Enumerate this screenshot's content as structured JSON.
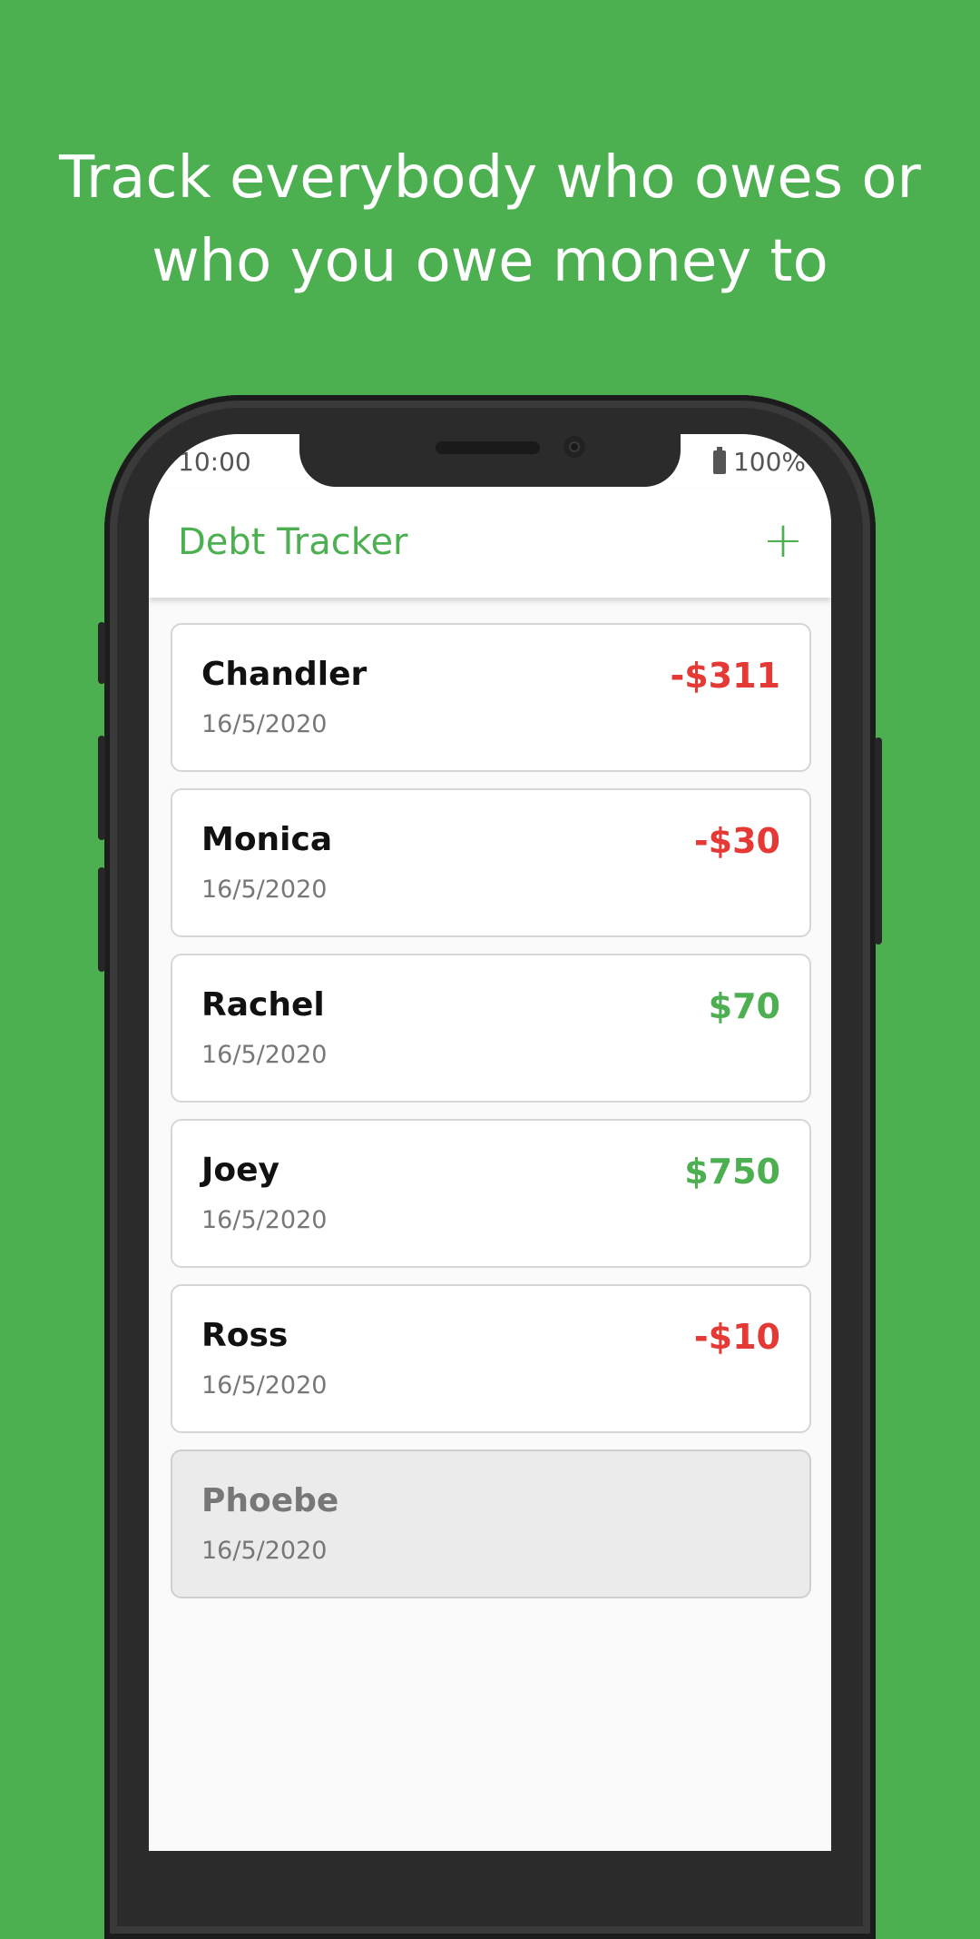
{
  "headline": {
    "line1": "Track everybody who owes or",
    "line2": "who you owe money to"
  },
  "status_bar": {
    "time": "10:00",
    "battery": "100%",
    "battery_icon": "battery-full-icon"
  },
  "app_bar": {
    "title": "Debt Tracker",
    "add_label": "+"
  },
  "colors": {
    "brand": "#4caf50",
    "negative": "#e53935",
    "positive": "#4caf50"
  },
  "debts": [
    {
      "name": "Chandler",
      "date": "16/5/2020",
      "amount": "-$311",
      "sign": "negative"
    },
    {
      "name": "Monica",
      "date": "16/5/2020",
      "amount": "-$30",
      "sign": "negative"
    },
    {
      "name": "Rachel",
      "date": "16/5/2020",
      "amount": "$70",
      "sign": "positive"
    },
    {
      "name": "Joey",
      "date": "16/5/2020",
      "amount": "$750",
      "sign": "positive"
    },
    {
      "name": "Ross",
      "date": "16/5/2020",
      "amount": "-$10",
      "sign": "negative"
    },
    {
      "name": "Phoebe",
      "date": "16/5/2020",
      "amount": "",
      "sign": "settled"
    }
  ]
}
